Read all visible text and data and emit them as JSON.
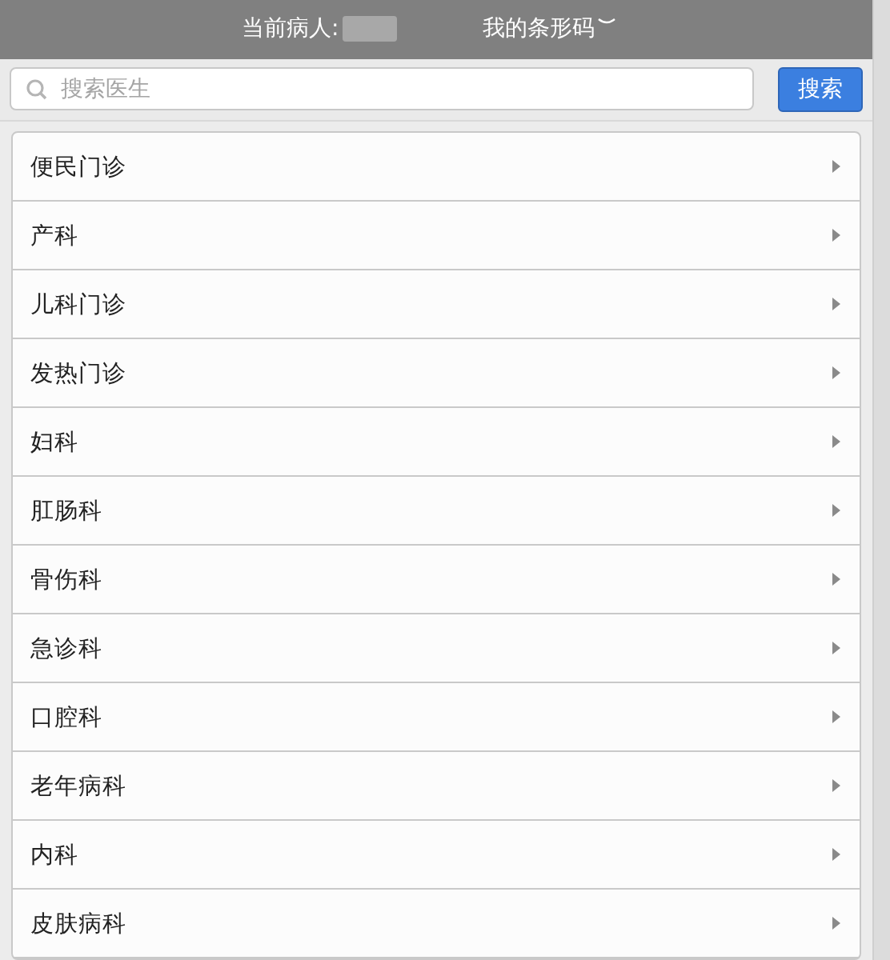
{
  "header": {
    "patient_label": "当前病人:",
    "barcode_link": "我的条形码"
  },
  "search": {
    "placeholder": "搜索医生",
    "button": "搜索"
  },
  "departments": [
    {
      "name": "便民门诊"
    },
    {
      "name": "产科"
    },
    {
      "name": "儿科门诊"
    },
    {
      "name": "发热门诊"
    },
    {
      "name": "妇科"
    },
    {
      "name": "肛肠科"
    },
    {
      "name": "骨伤科"
    },
    {
      "name": "急诊科"
    },
    {
      "name": "口腔科"
    },
    {
      "name": "老年病科"
    },
    {
      "name": "内科"
    },
    {
      "name": "皮肤病科"
    }
  ]
}
